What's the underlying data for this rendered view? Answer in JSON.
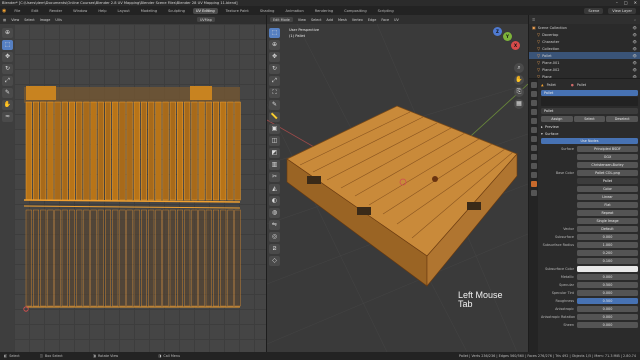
{
  "window": {
    "title": "Blender* [C:\\Users\\dem\\Documents\\Online Courses\\Blender 2.8 UV Mapping\\Blender Scene Files\\Blender 28 UV Mapping 11.blend]",
    "controls": [
      "–",
      "□",
      "✕"
    ]
  },
  "menu": {
    "items": [
      "File",
      "Edit",
      "Render",
      "Window",
      "Help"
    ],
    "workspaces": [
      "Layout",
      "Modeling",
      "Sculpting",
      "UV Editing",
      "Texture Paint",
      "Shading",
      "Animation",
      "Rendering",
      "Compositing",
      "Scripting"
    ],
    "active_workspace": "UV Editing",
    "scene": "Scene",
    "view_layer": "View Layer"
  },
  "uv_editor": {
    "header": [
      "View",
      "Select",
      "Image",
      "UVs"
    ],
    "image_name": "UVMap",
    "tools": [
      "cursor-icon",
      "move-icon",
      "rotate-icon",
      "scale-icon",
      "annotate-icon",
      "grab-icon",
      "relax-icon"
    ]
  },
  "viewport": {
    "header": [
      "Edit Mode",
      "View",
      "Select",
      "Add",
      "Mesh",
      "Vertex",
      "Edge",
      "Face",
      "UV"
    ],
    "info_line1": "User Perspective",
    "info_line2": "(1) Pallet",
    "overlay_line1": "Left Mouse",
    "overlay_line2": "Tab",
    "gizmo": {
      "x": "X",
      "y": "Y",
      "z": "Z"
    }
  },
  "outliner": {
    "header": "Scene Collection",
    "items": [
      {
        "label": "Scene Collection",
        "active": false
      },
      {
        "label": "Dovertop",
        "active": false
      },
      {
        "label": "Character",
        "active": false
      },
      {
        "label": "Collection",
        "active": false
      },
      {
        "label": "Pallet",
        "active": true
      },
      {
        "label": "Plane.001",
        "active": false
      },
      {
        "label": "Plane.002",
        "active": false
      },
      {
        "label": "Plane",
        "active": false
      }
    ]
  },
  "properties": {
    "object_name": "Pallet",
    "material_name": "Pallet",
    "material_slot": "Pallet",
    "slot_buttons": [
      "Assign",
      "Select",
      "Deselect"
    ],
    "sections": [
      "Preview",
      "Surface"
    ],
    "use_nodes": "Use Nodes",
    "surface_value": "Principled BSDF",
    "distribution": "GGX",
    "subsurface_method": "Christensen-Burley",
    "base_color_label": "Base Color",
    "base_color_value": "Pallet COL.png",
    "image_name": "Pallet",
    "image_options": [
      "Color",
      "Linear",
      "Flat",
      "Repeat",
      "Single Image"
    ],
    "vector": "Default",
    "fields": [
      {
        "label": "Subsurface",
        "value": "0.000"
      },
      {
        "label": "Subsurface Radius",
        "value": "1.000"
      },
      {
        "label": "",
        "value": "0.200"
      },
      {
        "label": "",
        "value": "0.100"
      },
      {
        "label": "Subsurface Color",
        "value": ""
      },
      {
        "label": "Metallic",
        "value": "0.000"
      },
      {
        "label": "Specular",
        "value": "0.500"
      },
      {
        "label": "Specular Tint",
        "value": "0.000"
      },
      {
        "label": "Roughness",
        "value": "0.500"
      },
      {
        "label": "Anisotropic",
        "value": "0.000"
      },
      {
        "label": "Anisotropic Rotation",
        "value": "0.000"
      },
      {
        "label": "Sheen",
        "value": "0.000"
      }
    ]
  },
  "statusbar": {
    "left": [
      "Select",
      "Box Select",
      "Rotate View",
      "Call Menu"
    ],
    "right": "Pallet | Verts 236/236 | Edges 560/560 | Faces 276/276 | Tris 492 | Objects 1/5 | Mem: 71.3 MiB | 2.80.74"
  },
  "colors": {
    "wood": "#c98a3a",
    "select_orange": "#f0a030",
    "accent_blue": "#4772b3"
  }
}
